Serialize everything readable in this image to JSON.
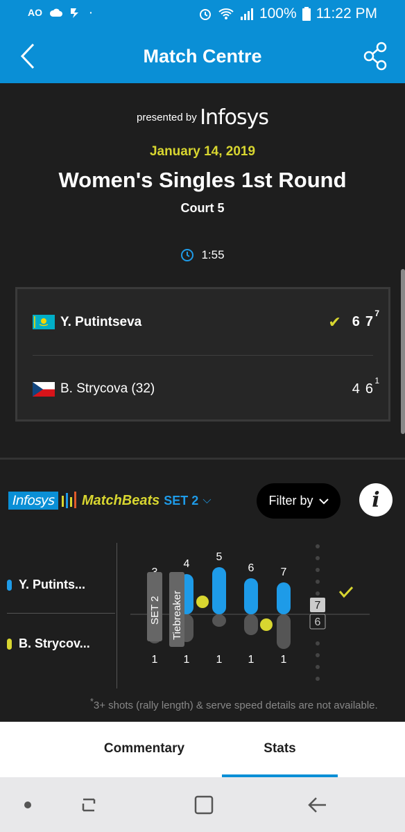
{
  "status_bar": {
    "left_icons": [
      "ao-icon",
      "cloud-icon",
      "check-app-icon",
      "dot-icon"
    ],
    "left_text": "AO",
    "battery": "100%",
    "time": "11:22 PM"
  },
  "app_bar": {
    "title": "Match Centre"
  },
  "header": {
    "presented_by": "presented by",
    "sponsor": "Infosys",
    "date": "January 14, 2019",
    "round": "Women's Singles 1st Round",
    "court": "Court 5",
    "duration": "1:55"
  },
  "players": [
    {
      "name": "Y. Putintseva",
      "winner": true,
      "sets": [
        "6",
        "7"
      ],
      "tiebreaks": [
        "",
        "7"
      ]
    },
    {
      "name": "B. Strycova (32)",
      "winner": false,
      "sets": [
        "4",
        "6"
      ],
      "tiebreaks": [
        "",
        "1"
      ]
    }
  ],
  "matchbeats": {
    "brand": "Infosys",
    "label": "MatchBeats",
    "set": "SET 2",
    "filter_label": "Filter by",
    "info_label": "i",
    "legend": [
      "Y. Putints...",
      "B. Strycov..."
    ],
    "colors": {
      "p1": "#1e9be8",
      "p2": "#d8d630"
    },
    "set_tag": "SET 2",
    "tiebreak_tag": "Tiebreaker",
    "games": [
      {
        "top": "3",
        "bottom": "1"
      },
      {
        "top": "4",
        "bottom": "1"
      },
      {
        "top": "5",
        "bottom": "1"
      },
      {
        "top": "6",
        "bottom": "1"
      },
      {
        "top": "7",
        "bottom": "1"
      }
    ],
    "final_top": "7",
    "final_bottom": "6",
    "footnote": "3+ shots (rally length) & serve speed details are not available."
  },
  "tabs": [
    {
      "label": "Commentary",
      "active": false
    },
    {
      "label": "Stats",
      "active": true
    }
  ]
}
